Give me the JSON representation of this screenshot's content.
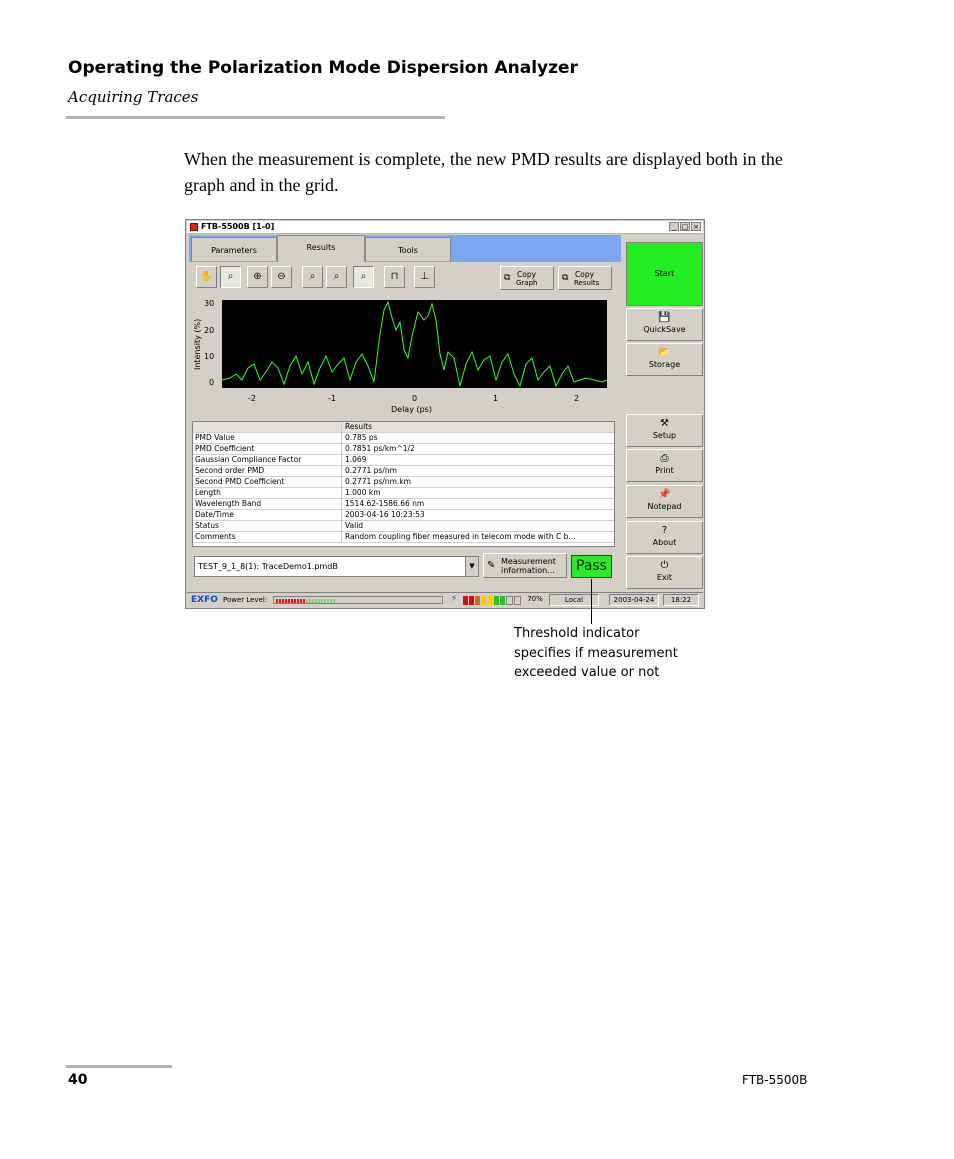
{
  "header": {
    "title": "Operating the Polarization Mode Dispersion Analyzer",
    "subtitle": "Acquiring Traces"
  },
  "body_text": "When the measurement is complete, the new PMD results are displayed both in the graph and in the grid.",
  "screenshot": {
    "window_title": "FTB-5500B [1-0]",
    "window_buttons": [
      "_",
      "□",
      "×"
    ],
    "tabs": [
      "Parameters",
      "Results",
      "Tools"
    ],
    "active_tab": "Results",
    "copy_graph": {
      "line1": "Copy",
      "line2": "Graph"
    },
    "copy_results": {
      "line1": "Copy",
      "line2": "Results"
    },
    "graph": {
      "ylabel": "Intensity (%)",
      "xlabel": "Delay (ps)",
      "y_ticks": [
        "30",
        "20",
        "10",
        "0"
      ],
      "x_ticks": [
        "-2",
        "-1",
        "0",
        "1",
        "2"
      ]
    },
    "grid": {
      "header": [
        "",
        "Results"
      ],
      "rows": [
        [
          "PMD Value",
          "0.785 ps"
        ],
        [
          "PMD Coefficient",
          "0.7851 ps/km^1/2"
        ],
        [
          "Gaussian Compliance Factor",
          "1.069"
        ],
        [
          "Second order PMD",
          "0.2771 ps/nm"
        ],
        [
          "Second PMD Coefficient",
          "0.2771 ps/nm.km"
        ],
        [
          "Length",
          "1.000 km"
        ],
        [
          "Wavelength Band",
          "1514.62-1586.66 nm"
        ],
        [
          "Date/Time",
          "2003-04-16 10:23:53"
        ],
        [
          "Status",
          "Valid"
        ],
        [
          "Comments",
          "Random coupling fiber measured in telecom mode with C b..."
        ]
      ]
    },
    "file_select": "TEST_9_1_8(1):  TraceDemo1.pmdB",
    "measurement_button": {
      "line1": "Measurement",
      "line2": "information..."
    },
    "pass_label": "Pass",
    "right_buttons": {
      "start": "Start",
      "quicksave": "QuickSave",
      "storage": "Storage",
      "setup": "Setup",
      "print": "Print",
      "notepad": "Notepad",
      "about": "About",
      "exit": "Exit"
    },
    "status_bar": {
      "brand": "EXFO",
      "power_label": "Power Level:",
      "battery": "70%",
      "mode": "Local",
      "date": "2003-04-24",
      "time": "18:22"
    }
  },
  "callout": "Threshold indicator specifies if measurement exceeded value or not",
  "footer": {
    "page_number": "40",
    "model": "FTB-5500B"
  },
  "colors": {
    "start_green": "#22ee22",
    "pass_green": "#2ee82e",
    "trace_green": "#33ff33",
    "tab_blue": "#7aa7f0"
  }
}
